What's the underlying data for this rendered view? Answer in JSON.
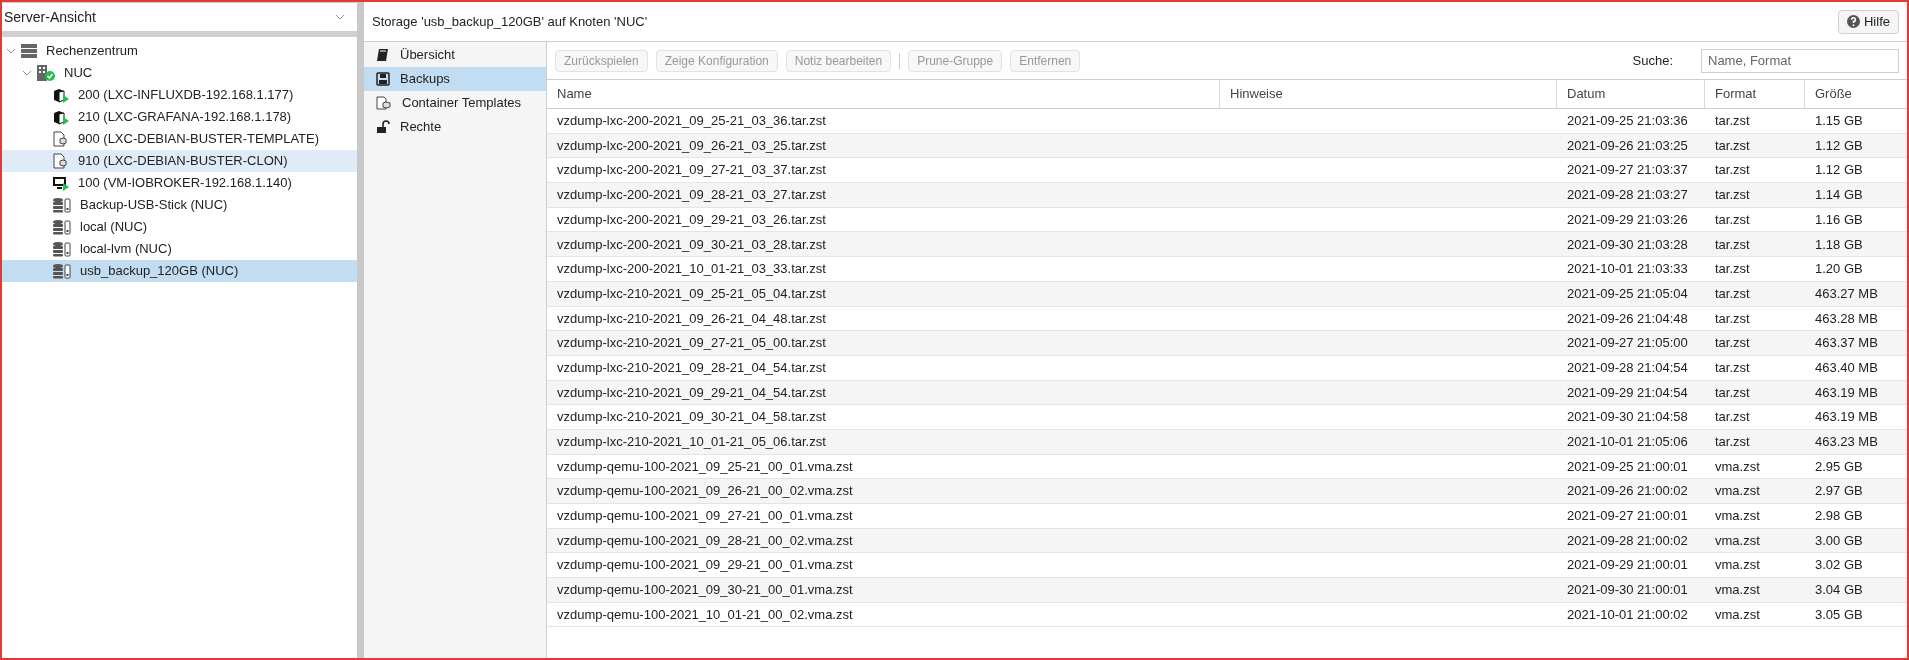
{
  "view_selector": {
    "value": "Server-Ansicht"
  },
  "tree": [
    {
      "label": "Rechenzentrum",
      "kind": "datacenter",
      "expanded": true,
      "selected": false,
      "hovered": false,
      "children": [
        {
          "label": "NUC",
          "kind": "node",
          "expanded": true,
          "selected": false,
          "hovered": false,
          "children": [
            {
              "label": "200 (LXC-INFLUXDB-192.168.1.177)",
              "kind": "container",
              "running": true,
              "selected": false,
              "hovered": false
            },
            {
              "label": "210 (LXC-GRAFANA-192.168.1.178)",
              "kind": "container",
              "running": true,
              "selected": false,
              "hovered": false
            },
            {
              "label": "900 (LXC-DEBIAN-BUSTER-TEMPLATE)",
              "kind": "template",
              "selected": false,
              "hovered": false
            },
            {
              "label": "910 (LXC-DEBIAN-BUSTER-CLON)",
              "kind": "template",
              "selected": false,
              "hovered": true
            },
            {
              "label": "100 (VM-IOBROKER-192.168.1.140)",
              "kind": "vm",
              "running": true,
              "selected": false,
              "hovered": false
            },
            {
              "label": "Backup-USB-Stick (NUC)",
              "kind": "storage",
              "selected": false,
              "hovered": false
            },
            {
              "label": "local (NUC)",
              "kind": "storage",
              "selected": false,
              "hovered": false
            },
            {
              "label": "local-lvm (NUC)",
              "kind": "storage",
              "selected": false,
              "hovered": false
            },
            {
              "label": "usb_backup_120GB (NUC)",
              "kind": "storage",
              "selected": true,
              "hovered": false
            }
          ]
        }
      ]
    }
  ],
  "panel_title": "Storage 'usb_backup_120GB' auf Knoten 'NUC'",
  "help_button": "Hilfe",
  "nav": [
    {
      "label": "Übersicht",
      "kind": "book",
      "selected": false
    },
    {
      "label": "Backups",
      "kind": "floppy",
      "selected": true
    },
    {
      "label": "Container Templates",
      "kind": "template",
      "selected": false
    },
    {
      "label": "Rechte",
      "kind": "lock",
      "selected": false
    }
  ],
  "toolbar": [
    {
      "label": "Zurückspielen",
      "disabled": true
    },
    {
      "label": "Zeige Konfiguration",
      "disabled": true
    },
    {
      "label": "Notiz bearbeiten",
      "disabled": true,
      "separator_after": true
    },
    {
      "label": "Prune-Gruppe",
      "disabled": true
    },
    {
      "label": "Entfernen",
      "disabled": true
    }
  ],
  "search": {
    "label": "Suche:",
    "placeholder": "Name, Format"
  },
  "table": {
    "columns": [
      "Name",
      "Hinweise",
      "Datum",
      "Format",
      "Größe"
    ],
    "rows": [
      [
        "vzdump-lxc-200-2021_09_25-21_03_36.tar.zst",
        "",
        "2021-09-25 21:03:36",
        "tar.zst",
        "1.15 GB"
      ],
      [
        "vzdump-lxc-200-2021_09_26-21_03_25.tar.zst",
        "",
        "2021-09-26 21:03:25",
        "tar.zst",
        "1.12 GB"
      ],
      [
        "vzdump-lxc-200-2021_09_27-21_03_37.tar.zst",
        "",
        "2021-09-27 21:03:37",
        "tar.zst",
        "1.12 GB"
      ],
      [
        "vzdump-lxc-200-2021_09_28-21_03_27.tar.zst",
        "",
        "2021-09-28 21:03:27",
        "tar.zst",
        "1.14 GB"
      ],
      [
        "vzdump-lxc-200-2021_09_29-21_03_26.tar.zst",
        "",
        "2021-09-29 21:03:26",
        "tar.zst",
        "1.16 GB"
      ],
      [
        "vzdump-lxc-200-2021_09_30-21_03_28.tar.zst",
        "",
        "2021-09-30 21:03:28",
        "tar.zst",
        "1.18 GB"
      ],
      [
        "vzdump-lxc-200-2021_10_01-21_03_33.tar.zst",
        "",
        "2021-10-01 21:03:33",
        "tar.zst",
        "1.20 GB"
      ],
      [
        "vzdump-lxc-210-2021_09_25-21_05_04.tar.zst",
        "",
        "2021-09-25 21:05:04",
        "tar.zst",
        "463.27 MB"
      ],
      [
        "vzdump-lxc-210-2021_09_26-21_04_48.tar.zst",
        "",
        "2021-09-26 21:04:48",
        "tar.zst",
        "463.28 MB"
      ],
      [
        "vzdump-lxc-210-2021_09_27-21_05_00.tar.zst",
        "",
        "2021-09-27 21:05:00",
        "tar.zst",
        "463.37 MB"
      ],
      [
        "vzdump-lxc-210-2021_09_28-21_04_54.tar.zst",
        "",
        "2021-09-28 21:04:54",
        "tar.zst",
        "463.40 MB"
      ],
      [
        "vzdump-lxc-210-2021_09_29-21_04_54.tar.zst",
        "",
        "2021-09-29 21:04:54",
        "tar.zst",
        "463.19 MB"
      ],
      [
        "vzdump-lxc-210-2021_09_30-21_04_58.tar.zst",
        "",
        "2021-09-30 21:04:58",
        "tar.zst",
        "463.19 MB"
      ],
      [
        "vzdump-lxc-210-2021_10_01-21_05_06.tar.zst",
        "",
        "2021-10-01 21:05:06",
        "tar.zst",
        "463.23 MB"
      ],
      [
        "vzdump-qemu-100-2021_09_25-21_00_01.vma.zst",
        "",
        "2021-09-25 21:00:01",
        "vma.zst",
        "2.95 GB"
      ],
      [
        "vzdump-qemu-100-2021_09_26-21_00_02.vma.zst",
        "",
        "2021-09-26 21:00:02",
        "vma.zst",
        "2.97 GB"
      ],
      [
        "vzdump-qemu-100-2021_09_27-21_00_01.vma.zst",
        "",
        "2021-09-27 21:00:01",
        "vma.zst",
        "2.98 GB"
      ],
      [
        "vzdump-qemu-100-2021_09_28-21_00_02.vma.zst",
        "",
        "2021-09-28 21:00:02",
        "vma.zst",
        "3.00 GB"
      ],
      [
        "vzdump-qemu-100-2021_09_29-21_00_01.vma.zst",
        "",
        "2021-09-29 21:00:01",
        "vma.zst",
        "3.02 GB"
      ],
      [
        "vzdump-qemu-100-2021_09_30-21_00_01.vma.zst",
        "",
        "2021-09-30 21:00:01",
        "vma.zst",
        "3.04 GB"
      ],
      [
        "vzdump-qemu-100-2021_10_01-21_00_02.vma.zst",
        "",
        "2021-10-01 21:00:02",
        "vma.zst",
        "3.05 GB"
      ]
    ]
  }
}
